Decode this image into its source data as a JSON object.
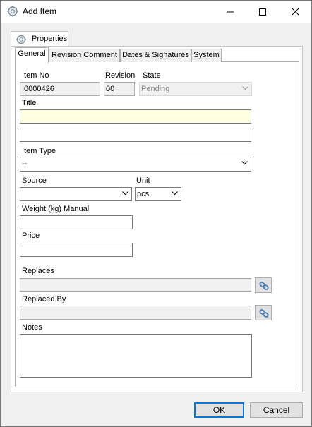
{
  "window": {
    "title": "Add Item"
  },
  "outer_tab": {
    "label": "Properties"
  },
  "tabs": [
    {
      "label": "General"
    },
    {
      "label": "Revision Comment"
    },
    {
      "label": "Dates & Signatures"
    },
    {
      "label": "System"
    }
  ],
  "form": {
    "item_no": {
      "label": "Item No",
      "value": "I0000426"
    },
    "revision": {
      "label": "Revision",
      "value": "00"
    },
    "state": {
      "label": "State",
      "value": "Pending"
    },
    "title": {
      "label": "Title",
      "value": "",
      "value2": ""
    },
    "item_type": {
      "label": "Item Type",
      "value": "--"
    },
    "source": {
      "label": "Source",
      "value": ""
    },
    "unit": {
      "label": "Unit",
      "value": "pcs"
    },
    "weight": {
      "label": "Weight (kg) Manual",
      "value": ""
    },
    "price": {
      "label": "Price",
      "value": ""
    },
    "replaces": {
      "label": "Replaces",
      "value": ""
    },
    "replaced_by": {
      "label": "Replaced By",
      "value": ""
    },
    "notes": {
      "label": "Notes",
      "value": ""
    }
  },
  "buttons": {
    "ok": "OK",
    "cancel": "Cancel"
  },
  "colors": {
    "required_field": "#ffffe1",
    "default_button_border": "#0078d7"
  }
}
